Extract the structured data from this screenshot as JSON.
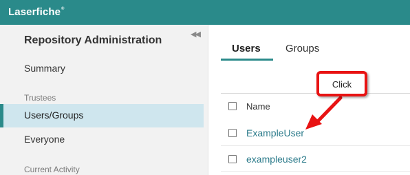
{
  "app": {
    "logo_text": "Laserfiche"
  },
  "sidebar": {
    "title": "Repository Administration",
    "summary": "Summary",
    "section_trustees": "Trustees",
    "users_groups": "Users/Groups",
    "everyone": "Everyone",
    "section_current_activity": "Current Activity",
    "collapse_icon": "double-chevron-left-icon"
  },
  "tabs": [
    {
      "label": "Users",
      "selected": true
    },
    {
      "label": "Groups",
      "selected": false
    }
  ],
  "table": {
    "header": "Name",
    "rows": [
      {
        "name": "ExampleUser"
      },
      {
        "name": "exampleuser2"
      }
    ]
  },
  "annotation": {
    "callout_text": "Click",
    "color": "#e81313"
  },
  "colors": {
    "accent": "#2a8a8a",
    "selected_row": "#cfe6ee",
    "link": "#2a7a8a"
  }
}
